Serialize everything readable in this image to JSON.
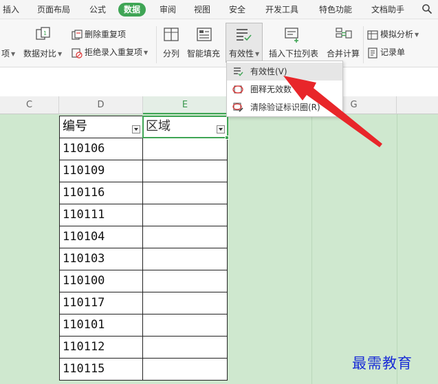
{
  "menu": {
    "tabs": [
      "插入",
      "页面布局",
      "公式",
      "数据",
      "审阅",
      "视图",
      "安全",
      "开发工具",
      "特色功能",
      "文档助手"
    ],
    "active_tab": "数据"
  },
  "ribbon": {
    "left_cut_label": "项",
    "data_compare": "数据对比",
    "delete_dup": "删除重复项",
    "reject_dup": "拒绝录入重复项",
    "split": "分列",
    "smart_fill": "智能填充",
    "validity": "有效性",
    "insert_dropdown": "插入下拉列表",
    "merge_calc": "合并计算",
    "simulate": "模拟分析",
    "record": "记录单"
  },
  "columns": [
    "C",
    "D",
    "E",
    "G"
  ],
  "sheet": {
    "header_d": "编号",
    "header_e": "区域",
    "ids": [
      "110106",
      "110109",
      "110116",
      "110111",
      "110104",
      "110103",
      "110100",
      "110117",
      "110101",
      "110112",
      "110115"
    ]
  },
  "dropdown": {
    "items": [
      "有效性(V)",
      "圈释无效数",
      "清除验证标识圈(R)"
    ]
  },
  "watermark": "最需教育",
  "colors": {
    "accent": "#3fa555",
    "grid_bg": "#cfe8cf",
    "arrow": "#e8262a",
    "watermark": "#1a2dd6"
  }
}
